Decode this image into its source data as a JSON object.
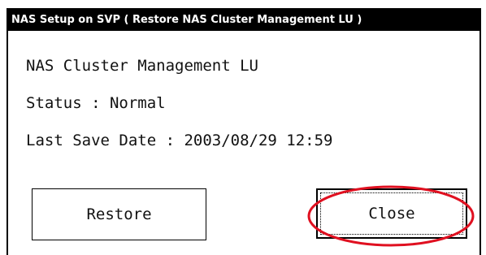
{
  "dialog": {
    "title": "NAS Setup on SVP ( Restore NAS Cluster Management LU )",
    "lu_name": "NAS Cluster Management LU",
    "status_text": "Status : Normal",
    "last_save_text": "Last Save Date : 2003/08/29 12:59"
  },
  "buttons": {
    "restore_label": "Restore",
    "close_label": "Close"
  },
  "annotation": {
    "highlight_color": "#e01020"
  }
}
